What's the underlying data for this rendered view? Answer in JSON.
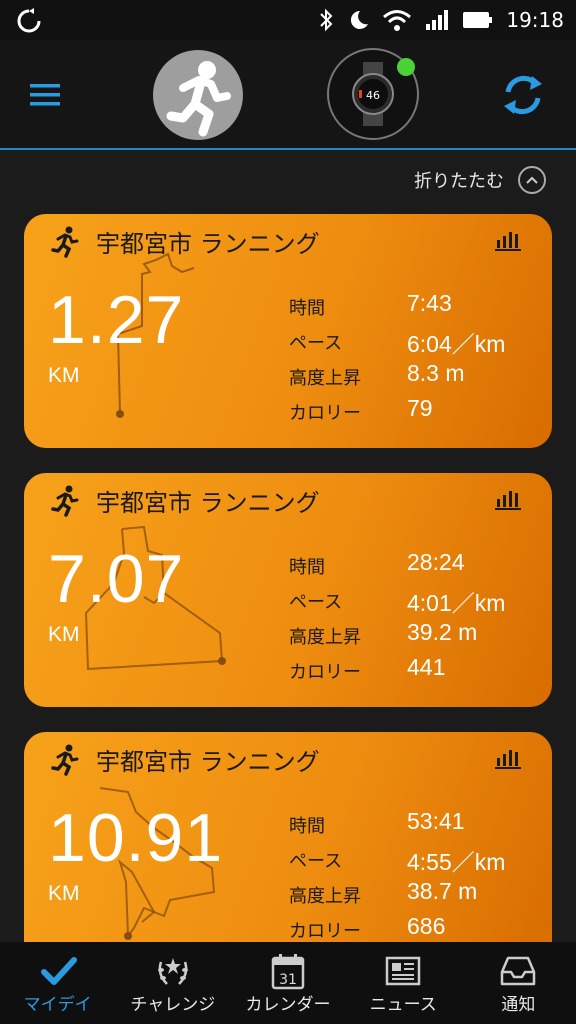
{
  "status_bar": {
    "time": "19:18",
    "icons": [
      "sync-icon",
      "bluetooth-icon",
      "moon-icon",
      "wifi-icon",
      "signal-icon",
      "battery-icon"
    ]
  },
  "header": {
    "menu_icon": "hamburger-icon",
    "avatar_icon": "runner-avatar-icon",
    "device_icon": "watch-icon",
    "device_connected_color": "#4cd137",
    "sync_icon": "sync-icon",
    "accent_color": "#1e88c8"
  },
  "collapse": {
    "label": "折りたたむ",
    "icon": "chevron-up-icon"
  },
  "activities": [
    {
      "title": "宇都宮市 ランニング",
      "distance": "1.27",
      "unit": "KM",
      "stats": [
        {
          "label": "時間",
          "value": "7:43"
        },
        {
          "label": "ペース",
          "value": "6:04／km"
        },
        {
          "label": "高度上昇",
          "value": "8.3 m"
        },
        {
          "label": "カロリー",
          "value": "79"
        }
      ]
    },
    {
      "title": "宇都宮市 ランニング",
      "distance": "7.07",
      "unit": "KM",
      "stats": [
        {
          "label": "時間",
          "value": "28:24"
        },
        {
          "label": "ペース",
          "value": "4:01／km"
        },
        {
          "label": "高度上昇",
          "value": "39.2 m"
        },
        {
          "label": "カロリー",
          "value": "441"
        }
      ]
    },
    {
      "title": "宇都宮市 ランニング",
      "distance": "10.91",
      "unit": "KM",
      "stats": [
        {
          "label": "時間",
          "value": "53:41"
        },
        {
          "label": "ペース",
          "value": "4:55／km"
        },
        {
          "label": "高度上昇",
          "value": "38.7 m"
        },
        {
          "label": "カロリー",
          "value": "686"
        }
      ]
    }
  ],
  "card_colors": {
    "start": "#f7a21a",
    "end": "#d86c00"
  },
  "bottom_nav": [
    {
      "label": "マイデイ",
      "icon": "checkmark-icon",
      "active": true
    },
    {
      "label": "チャレンジ",
      "icon": "laurel-icon",
      "active": false
    },
    {
      "label": "カレンダー",
      "icon": "calendar-icon",
      "active": false
    },
    {
      "label": "ニュース",
      "icon": "newspaper-icon",
      "active": false
    },
    {
      "label": "通知",
      "icon": "inbox-icon",
      "active": false
    }
  ],
  "calendar_day": "31"
}
